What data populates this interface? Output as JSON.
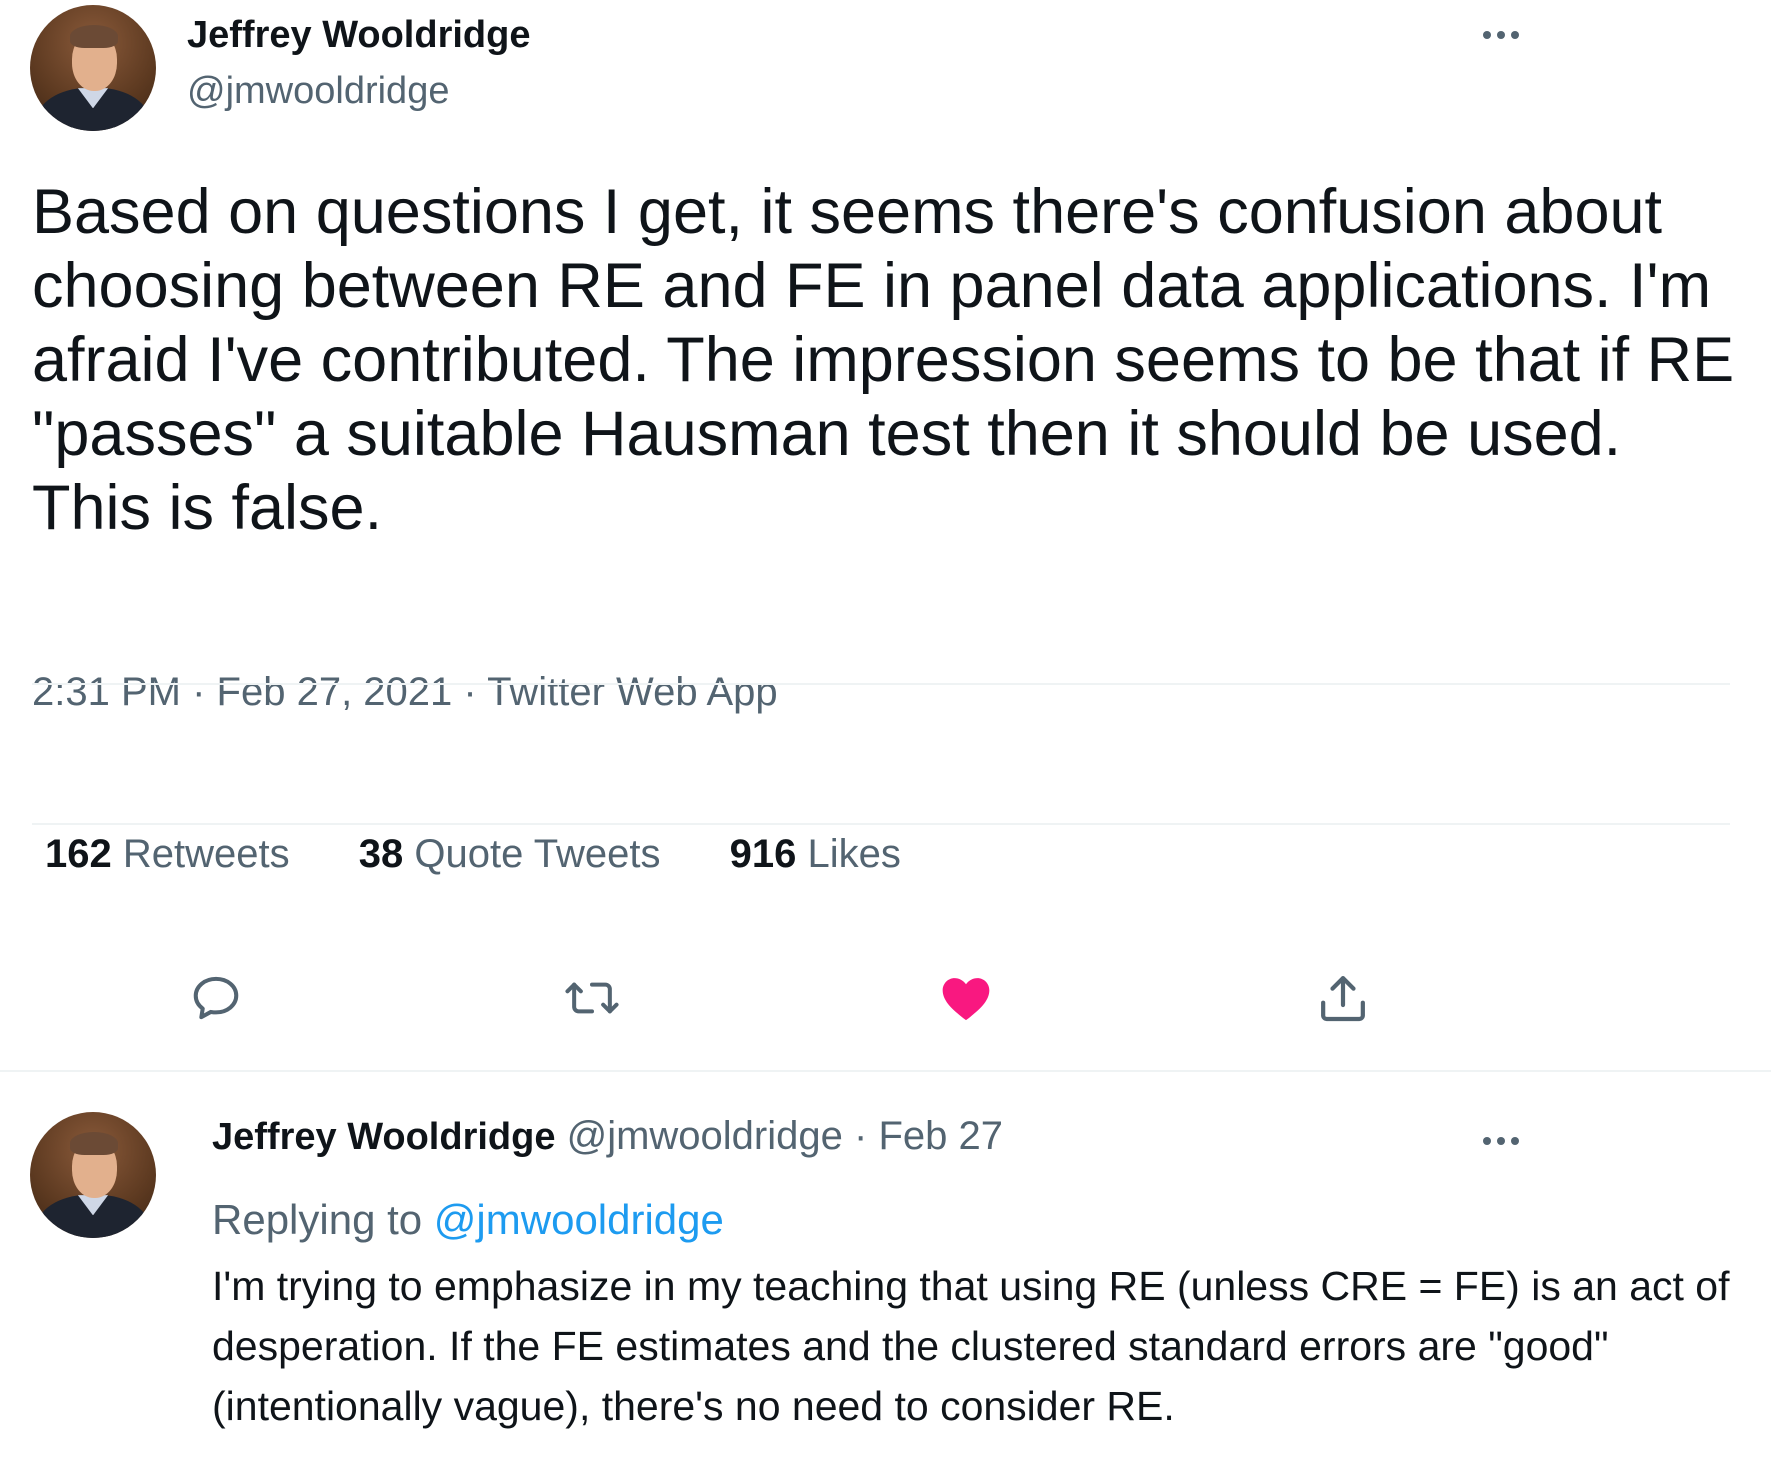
{
  "tweet": {
    "author_name": "Jeffrey Wooldridge",
    "author_handle": "@jmwooldridge",
    "text": "Based on questions I get, it seems there's confusion about choosing between RE and FE in panel data applications. I'm afraid I've contributed. The impression seems to be that if RE \"passes\" a suitable Hausman test then it should be used. This is false.",
    "time": "2:31 PM",
    "date": "Feb 27, 2021",
    "source": "Twitter Web App",
    "separator": "·",
    "stats": {
      "retweets_count": "162",
      "retweets_label": "Retweets",
      "quotes_count": "38",
      "quotes_label": "Quote Tweets",
      "likes_count": "916",
      "likes_label": "Likes"
    },
    "actions": {
      "reply_icon": "reply-icon",
      "retweet_icon": "retweet-icon",
      "like_icon": "heart-icon",
      "share_icon": "share-icon",
      "liked": true,
      "like_color": "#f91880"
    }
  },
  "reply": {
    "author_name": "Jeffrey Wooldridge",
    "author_handle": "@jmwooldridge",
    "date": "Feb 27",
    "separator": "·",
    "replying_label": "Replying to",
    "replying_to": "@jmwooldridge",
    "text": "I'm trying to emphasize in my teaching that using RE (unless CRE = FE) is an act of desperation. If the FE estimates and the clustered standard errors are \"good\" (intentionally vague), there's no need to consider RE."
  },
  "colors": {
    "text_primary": "#0f1419",
    "text_secondary": "#536471",
    "link": "#1d9bf0",
    "divider": "#eff3f4"
  }
}
